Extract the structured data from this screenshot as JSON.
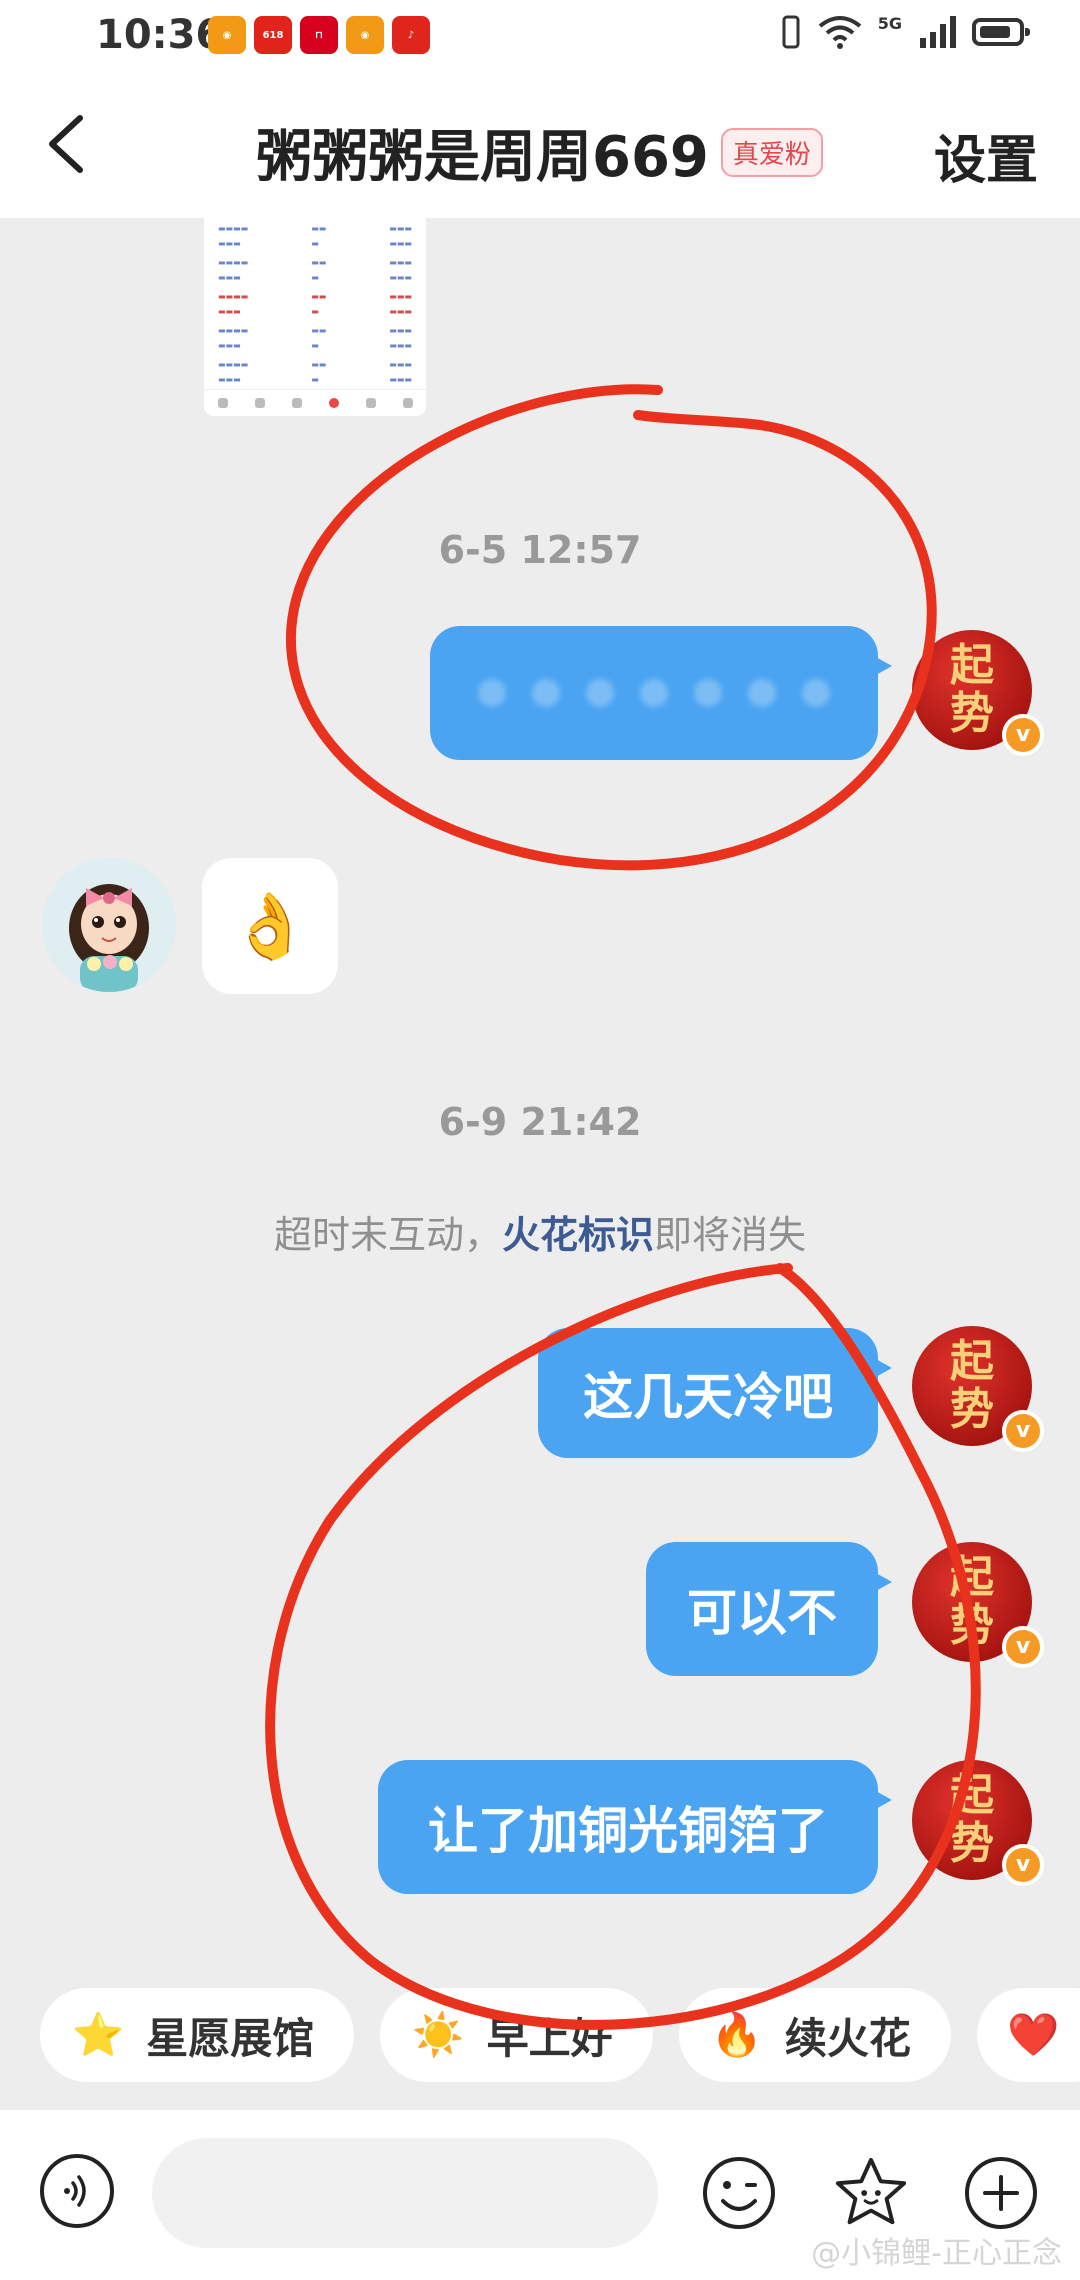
{
  "status_bar": {
    "time": "10:36",
    "app_icons": [
      {
        "name": "weibo-app-icon",
        "label": "",
        "color": "#f29a16"
      },
      {
        "name": "618-app-icon",
        "label": "618",
        "color": "#e2231a"
      },
      {
        "name": "red-app-icon",
        "label": "",
        "color": "#d7001f"
      },
      {
        "name": "weibo-app-icon",
        "label": "",
        "color": "#f29a16"
      },
      {
        "name": "netease-music-app-icon",
        "label": "",
        "color": "#e0251c"
      }
    ],
    "network": "5G"
  },
  "header": {
    "title": "粥粥粥是周周669",
    "badge": "真爱粉",
    "settings_label": "设置"
  },
  "messages": {
    "ts1": "6-5 12:57",
    "reply_emoji": "👌",
    "ts2": "6-9 21:42",
    "notice_prefix": "超时未互动，",
    "notice_highlight": "火花标识",
    "notice_suffix": "即将消失",
    "msg1": "这几天冷吧",
    "msg2": "可以不",
    "msg3": "让了加铜光铜箔了"
  },
  "avatar": {
    "self_line1": "起",
    "self_line2": "势",
    "verified": "v"
  },
  "chips": [
    {
      "icon": "⭐",
      "label": "星愿展馆"
    },
    {
      "icon": "☀️",
      "label": "早上好"
    },
    {
      "icon": "🔥",
      "label": "续火花"
    },
    {
      "icon": "❤️",
      "label": ""
    }
  ],
  "watermark": "@小锦鲤-正心正念",
  "colors": {
    "bubble_blue": "#4aa4f2",
    "annotation_red": "#e8321e",
    "badge_red": "#e5474d"
  }
}
